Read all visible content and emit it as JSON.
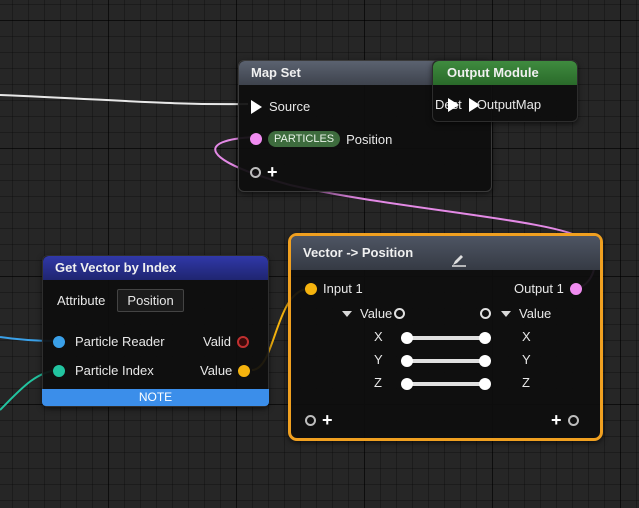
{
  "nodes": {
    "map_set": {
      "title": "Map Set",
      "source_label": "Source",
      "particles_badge": "PARTICLES",
      "position_label": "Position",
      "add_label": "+"
    },
    "output_module": {
      "title": "Output Module",
      "dest_label": "Dest",
      "output_map_label": "OutputMap"
    },
    "get_vector": {
      "title": "Get Vector by Index",
      "attribute_label": "Attribute",
      "attribute_value": "Position",
      "particle_reader_label": "Particle Reader",
      "valid_label": "Valid",
      "particle_index_label": "Particle Index",
      "value_label": "Value",
      "note_label": "NOTE"
    },
    "vector_position": {
      "title": "Vector -> Position",
      "input_label": "Input 1",
      "output_label": "Output 1",
      "left_value_label": "Value",
      "right_value_label": "Value",
      "axes": [
        "X",
        "Y",
        "Z"
      ],
      "add_left": "+",
      "add_right": "+"
    }
  },
  "colors": {
    "orange_pin": "#f5b30e",
    "pink_pin": "#f08cf0",
    "blue_pin": "#3aa0e8",
    "teal_pin": "#22c4a0",
    "red_pin": "#c03030",
    "selected_border": "#f0a020",
    "get_vector_header": "#2a2f8e",
    "output_module_header": "#2f7a2f",
    "note_bar": "#3b8eea"
  }
}
